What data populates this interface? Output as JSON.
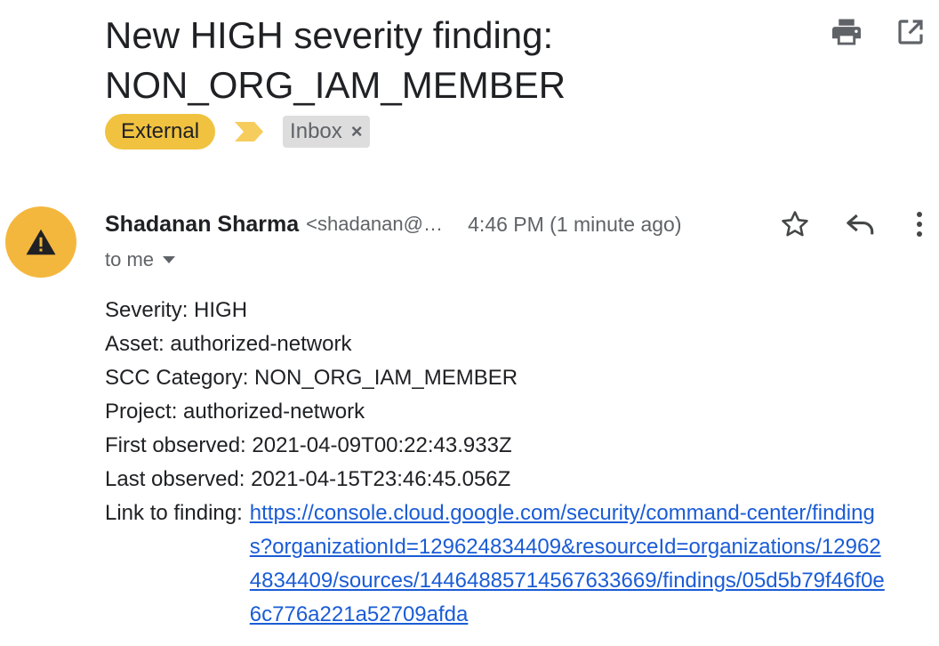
{
  "email": {
    "subject": "New HIGH severity finding: NON_ORG_IAM_MEMBER",
    "labels": {
      "external": "External",
      "inbox": "Inbox",
      "inbox_remove": "×"
    },
    "sender": {
      "name": "Shadanan Sharma",
      "email": "<shadanan@…",
      "time": "4:46 PM (1 minute ago)"
    },
    "recipient": "to me",
    "body": {
      "severity": "Severity: HIGH",
      "asset": "Asset: authorized-network",
      "category": "SCC Category: NON_ORG_IAM_MEMBER",
      "project": "Project: authorized-network",
      "first_observed": "First observed: 2021-04-09T00:22:43.933Z",
      "last_observed": "Last observed: 2021-04-15T23:46:45.056Z",
      "link_label": "Link to finding:",
      "link_url": "https://console.cloud.google.com/security/command-center/findings?organizationId=129624834409&resourceId=organizations/129624834409/sources/14464885714567633669/findings/05d5b79f46f0e6c776a221a52709afda"
    }
  },
  "icons": {
    "print": "print-icon",
    "open_new_window": "open-in-new-window-icon",
    "importance": "importance-marker-icon",
    "warning": "warning-icon",
    "star": "star-icon",
    "reply": "reply-icon",
    "more": "more-vertical-icon",
    "dropdown": "dropdown-arrow-icon"
  },
  "colors": {
    "external_label": "#f0c240",
    "avatar": "#f4b73d",
    "link": "#1a5cd6",
    "inbox_label": "#dddddd"
  }
}
